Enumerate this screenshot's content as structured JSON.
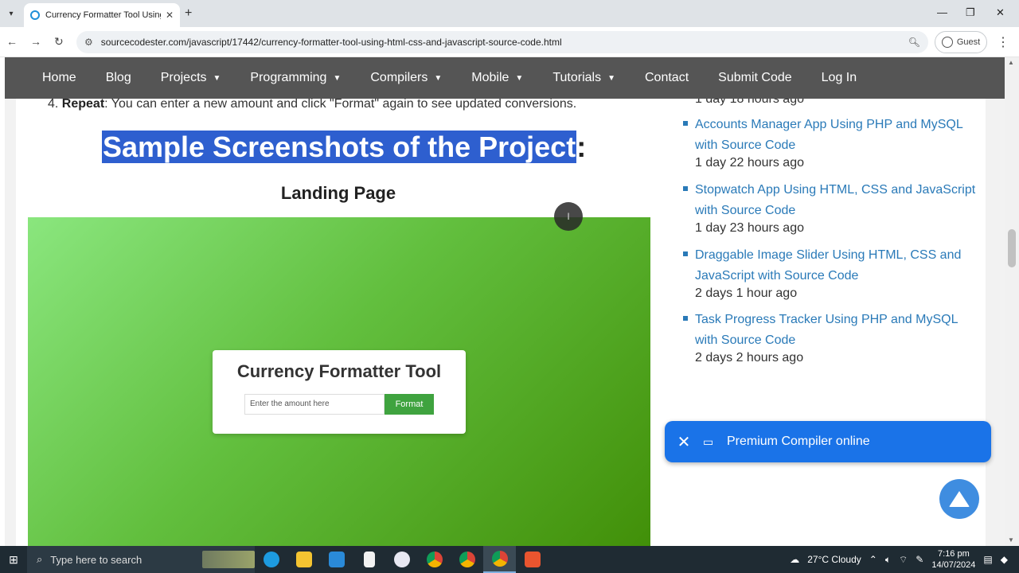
{
  "browser": {
    "tab_title": "Currency Formatter Tool Using",
    "url": "sourcecodester.com/javascript/17442/currency-formatter-tool-using-html-css-and-javascript-source-code.html",
    "profile_label": "Guest"
  },
  "site_nav": {
    "items": [
      {
        "label": "Home",
        "dropdown": false
      },
      {
        "label": "Blog",
        "dropdown": false
      },
      {
        "label": "Projects",
        "dropdown": true
      },
      {
        "label": "Programming",
        "dropdown": true
      },
      {
        "label": "Compilers",
        "dropdown": true
      },
      {
        "label": "Mobile",
        "dropdown": true
      },
      {
        "label": "Tutorials",
        "dropdown": true
      },
      {
        "label": "Contact",
        "dropdown": false
      },
      {
        "label": "Submit Code",
        "dropdown": false
      },
      {
        "label": "Log In",
        "dropdown": false
      }
    ]
  },
  "article": {
    "step_number": "4.",
    "step_bold": "Repeat",
    "step_text": ": You can enter a new amount and click \"Format\" again to see updated conversions.",
    "heading_selected": "Sample Screenshots of the Project",
    "heading_tail": ":",
    "subheading": "Landing Page",
    "screenshot": {
      "card_title": "Currency Formatter Tool",
      "input_placeholder": "Enter the amount here",
      "button_label": "Format"
    }
  },
  "sidebar": {
    "partial_time": "1 day 18 hours ago",
    "posts": [
      {
        "title": "Accounts Manager App Using PHP and MySQL with Source Code",
        "time": "1 day 22 hours ago"
      },
      {
        "title": "Stopwatch App Using HTML, CSS and JavaScript with Source Code",
        "time": "1 day 23 hours ago"
      },
      {
        "title": "Draggable Image Slider Using HTML, CSS and JavaScript with Source Code",
        "time": "2 days 1 hour ago"
      },
      {
        "title": "Task Progress Tracker Using PHP and MySQL with Source Code",
        "time": "2 days 2 hours ago"
      }
    ]
  },
  "promo": {
    "label": "Premium Compiler online"
  },
  "taskbar": {
    "search_placeholder": "Type here to search",
    "weather": "27°C  Cloudy",
    "time": "7:16 pm",
    "date": "14/07/2024"
  }
}
